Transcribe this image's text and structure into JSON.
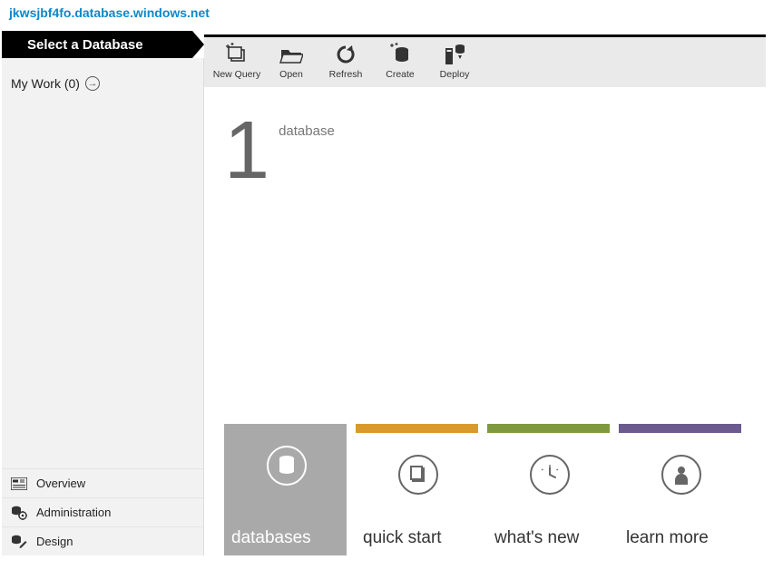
{
  "breadcrumb": {
    "server": "jkwsjbf4fo.database.windows.net"
  },
  "sidebar": {
    "selectLabel": "Select a Database",
    "myWorkLabel": "My Work (0)",
    "nav": {
      "overview": "Overview",
      "administration": "Administration",
      "design": "Design"
    }
  },
  "toolbar": {
    "newQuery": "New Query",
    "open": "Open",
    "refresh": "Refresh",
    "create": "Create",
    "deploy": "Deploy"
  },
  "stat": {
    "count": "1",
    "label": "database"
  },
  "tiles": {
    "databases": {
      "label": "databases",
      "accent": "#a9a9a9"
    },
    "quickstart": {
      "label": "quick start",
      "accent": "#da9a2b"
    },
    "whatsnew": {
      "label": "what's new",
      "accent": "#7f9a3e"
    },
    "learnmore": {
      "label": "learn more",
      "accent": "#6b5a8e"
    }
  }
}
